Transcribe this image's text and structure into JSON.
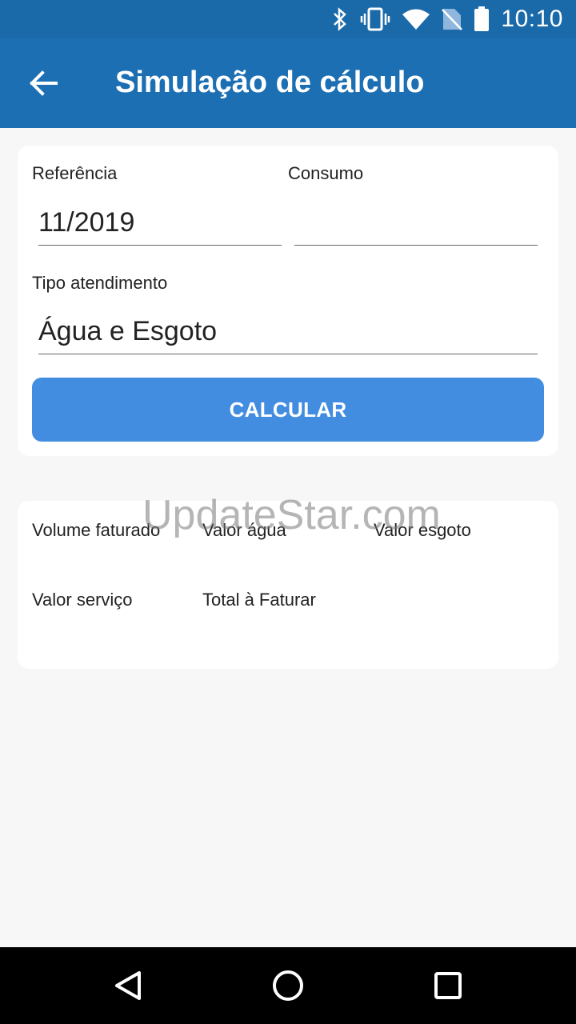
{
  "status_bar": {
    "time": "10:10",
    "icons": [
      "bluetooth-icon",
      "vibrate-icon",
      "wifi-icon",
      "no-sim-icon",
      "battery-icon"
    ]
  },
  "app_bar": {
    "title": "Simulação de cálculo",
    "back_icon": "arrow-left-icon",
    "color": "#1b6fb2"
  },
  "form": {
    "referencia_label": "Referência",
    "referencia_value": "11/2019",
    "consumo_label": "Consumo",
    "consumo_value": "",
    "tipo_label": "Tipo atendimento",
    "tipo_value": "Água e Esgoto",
    "calc_button": "CALCULAR",
    "button_color": "#428de0"
  },
  "result": {
    "volume_label": "Volume faturado",
    "agua_label": "Valor água",
    "esgoto_label": "Valor esgoto",
    "servico_label": "Valor serviço",
    "total_label": "Total à Faturar"
  },
  "watermark": "UpdateStar.com",
  "nav_bar": {
    "icons": [
      "back-triangle-icon",
      "home-circle-icon",
      "recents-square-icon"
    ]
  }
}
